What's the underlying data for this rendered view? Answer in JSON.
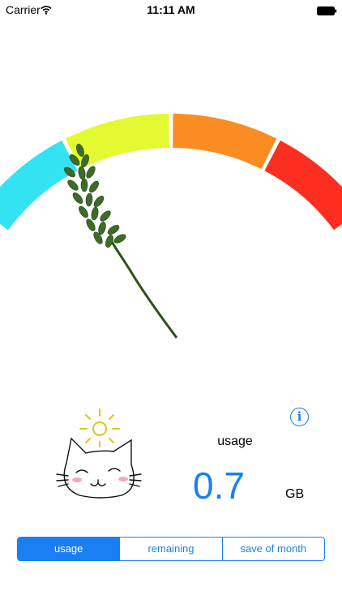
{
  "status_bar": {
    "carrier": "Carrier",
    "time": "11:11 AM",
    "wifi_icon": "wifi-icon",
    "battery_icon": "battery-icon"
  },
  "gauge": {
    "segments": [
      {
        "color": "#33e3f2"
      },
      {
        "color": "#e4fa30"
      },
      {
        "color": "#fb8c22"
      },
      {
        "color": "#fc2e20"
      }
    ],
    "needle_icon": "lavender-sprig-needle"
  },
  "mascot_icon": "cat-with-sun-icon",
  "info_icon": {
    "glyph": "i"
  },
  "metric": {
    "label": "usage",
    "value": "0.7",
    "unit": "GB"
  },
  "segmented_control": {
    "items": [
      {
        "label": "usage",
        "active": true
      },
      {
        "label": "remaining",
        "active": false
      },
      {
        "label": "save of month",
        "active": false
      }
    ]
  },
  "colors": {
    "accent": "#1a7ff2"
  }
}
